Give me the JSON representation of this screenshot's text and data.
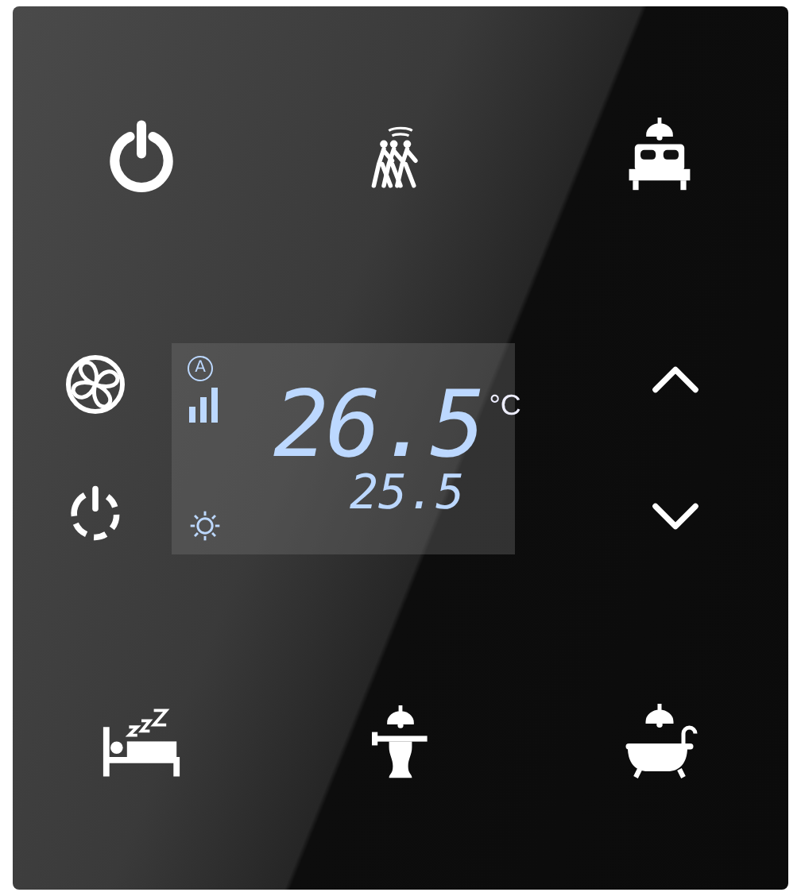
{
  "top_buttons": [
    {
      "kind": "power"
    },
    {
      "kind": "presence"
    },
    {
      "kind": "bed-lamp"
    }
  ],
  "left_buttons": [
    {
      "kind": "fan"
    },
    {
      "kind": "timer"
    }
  ],
  "display": {
    "fan_mode": "A",
    "set_temperature": "26.5",
    "unit": "°C",
    "heating": true,
    "room_temperature": "25.5"
  },
  "right_buttons": [
    {
      "kind": "up"
    },
    {
      "kind": "down"
    }
  ],
  "bottom_buttons": [
    {
      "kind": "sleep"
    },
    {
      "kind": "table-lamp"
    },
    {
      "kind": "bath-lamp"
    }
  ]
}
